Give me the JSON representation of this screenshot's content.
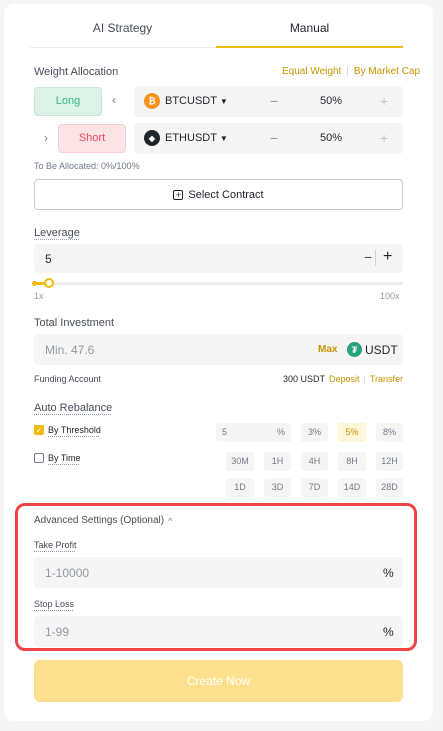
{
  "tabs": [
    "AI Strategy",
    "Manual"
  ],
  "weight": {
    "label": "Weight Allocation",
    "equal": "Equal Weight",
    "sep": "|",
    "market": "By Market Cap"
  },
  "positions": [
    {
      "side": "Long",
      "symbol": "BTCUSDT",
      "percent": "50%",
      "coin_color": "#f7931a",
      "coin_glyph": "₿",
      "arrow": "‹"
    },
    {
      "side": "Short",
      "symbol": "ETHUSDT",
      "percent": "50%",
      "coin_color": "#1e2329",
      "coin_glyph": "◆",
      "arrow": "›"
    }
  ],
  "allocated": "To Be Allocated: 0%/100%",
  "select_contract": "Select Contract",
  "leverage": {
    "label": "Leverage",
    "value": "5",
    "min": "1x",
    "max": "100x",
    "level": 0.04
  },
  "investment": {
    "label": "Total Investment",
    "placeholder": "Min. 47.6",
    "max": "Max",
    "currency": "USDT"
  },
  "funding": {
    "label": "Funding Account",
    "amount": "300 USDT",
    "deposit": "Deposit",
    "sep": "|",
    "transfer": "Transfer"
  },
  "rebalance": {
    "label": "Auto Rebalance",
    "by_threshold": "By Threshold",
    "by_time": "By Time",
    "threshold_value": "5",
    "threshold_unit": "%",
    "threshold_chips": [
      "3%",
      "5%",
      "8%"
    ],
    "time_chips_row1": [
      "30M",
      "1H",
      "4H",
      "8H",
      "12H"
    ],
    "time_chips_row2": [
      "1D",
      "3D",
      "7D",
      "14D",
      "28D"
    ]
  },
  "advanced": {
    "label": "Advanced Settings (Optional)",
    "take_profit_label": "Take Profit",
    "take_profit_placeholder": "1-10000",
    "stop_loss_label": "Stop Loss",
    "stop_loss_placeholder": "1-99",
    "unit": "%"
  },
  "create": "Create Now",
  "icons": {
    "minus": "−",
    "plus": "+",
    "chevron_up": "^",
    "check": "✓",
    "add_square": "+"
  }
}
